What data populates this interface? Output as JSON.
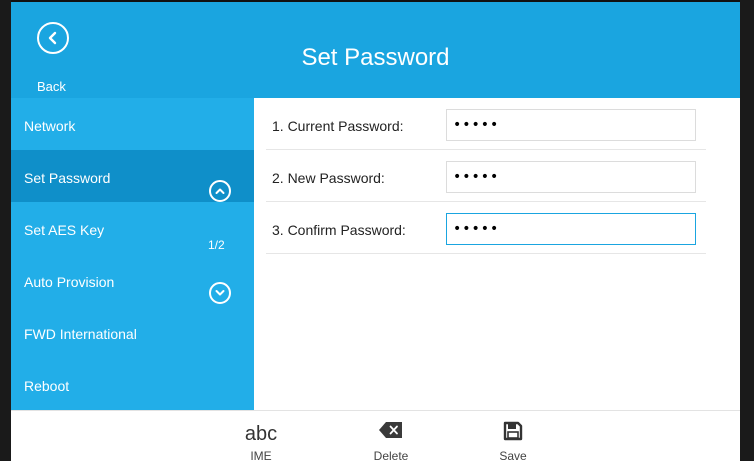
{
  "header": {
    "title": "Set Password",
    "back_label": "Back"
  },
  "sidebar": {
    "items": [
      {
        "label": "Network"
      },
      {
        "label": "Set Password"
      },
      {
        "label": "Set AES Key"
      },
      {
        "label": "Auto Provision"
      },
      {
        "label": "FWD International"
      },
      {
        "label": "Reboot"
      }
    ],
    "active_index": 1,
    "page_indicator": "1/2"
  },
  "form": {
    "rows": [
      {
        "label": "1. Current Password:",
        "value": "•••••"
      },
      {
        "label": "2. New Password:",
        "value": "•••••"
      },
      {
        "label": "3. Confirm Password:",
        "value": "•••••"
      }
    ]
  },
  "softkeys": {
    "ime_value": "abc",
    "ime_label": "IME",
    "delete_label": "Delete",
    "save_label": "Save"
  },
  "colors": {
    "accent": "#1aa5e0",
    "sidebar": "#22aee8",
    "sidebar_active": "#0f8fc9"
  }
}
